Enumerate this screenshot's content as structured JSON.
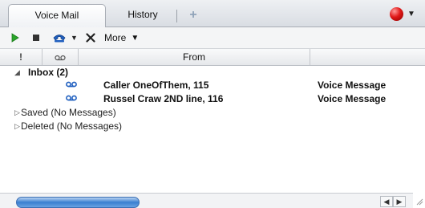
{
  "tabs": [
    {
      "label": "Voice Mail"
    },
    {
      "label": "History"
    }
  ],
  "tab_add_label": "+",
  "toolbar": {
    "more_label": "More"
  },
  "columns": {
    "flag": "!",
    "from": "From"
  },
  "inbox": {
    "label": "Inbox (2)",
    "messages": [
      {
        "from": "Caller OneOfThem, 115",
        "type": "Voice Message"
      },
      {
        "from": "Russel Craw 2ND line, 116",
        "type": "Voice Message"
      }
    ]
  },
  "saved": {
    "label": "Saved (No Messages)"
  },
  "deleted": {
    "label": "Deleted (No Messages)"
  },
  "colors": {
    "accent": "#3a7fd0",
    "play": "#2aa52a",
    "status": "#e01818",
    "voicemail_icon": "#1f5fbf"
  },
  "icons": [
    "play-icon",
    "stop-icon",
    "voicemail-icon",
    "delete-icon",
    "status-icon",
    "voicemail-message-icon"
  ]
}
